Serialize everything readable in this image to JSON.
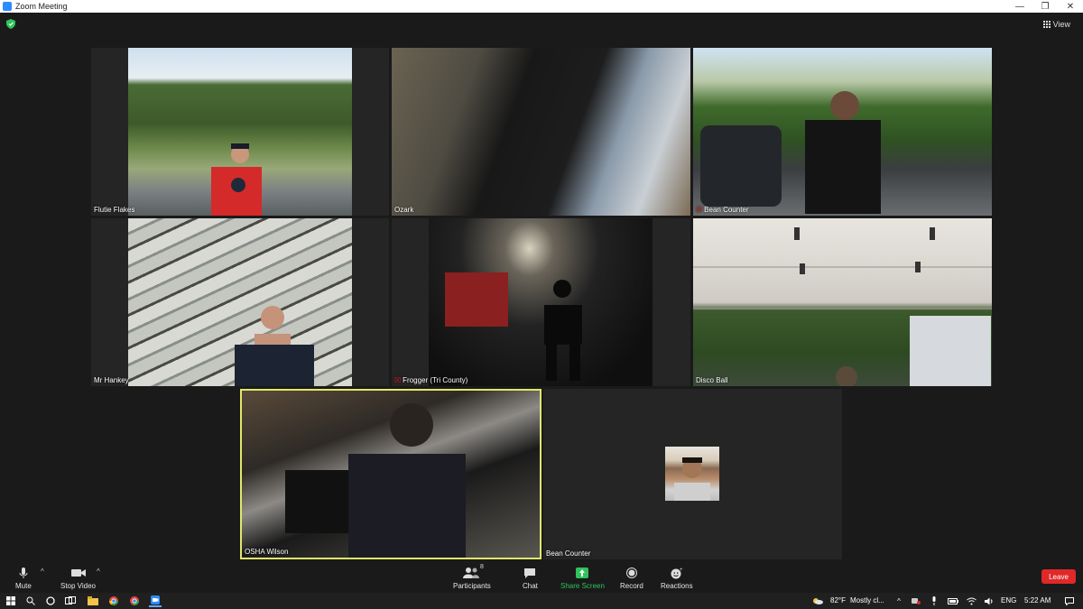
{
  "window": {
    "title": "Zoom Meeting"
  },
  "view_button": {
    "label": "View"
  },
  "participants_tiles": [
    {
      "name": "Flutie Flakes"
    },
    {
      "name": "Ozark"
    },
    {
      "name": "Bean Counter",
      "muted": true
    },
    {
      "name": "Mr Hankey"
    },
    {
      "name": "Frogger (Tri County)",
      "muted": true
    },
    {
      "name": "Disco Ball"
    },
    {
      "name": "OSHA Wilson",
      "active_speaker": true
    },
    {
      "name": "Bean Counter",
      "video_off": true
    }
  ],
  "toolbar": {
    "mute_label": "Mute",
    "stop_video_label": "Stop Video",
    "participants_label": "Participants",
    "participants_count": "8",
    "chat_label": "Chat",
    "share_screen_label": "Share Screen",
    "record_label": "Record",
    "reactions_label": "Reactions",
    "leave_label": "Leave"
  },
  "taskbar": {
    "weather": "82°F",
    "weather_desc": "Mostly cl...",
    "language": "ENG",
    "time": "5:22 AM"
  },
  "colors": {
    "active_speaker_border": "#dfe86a",
    "leave_button": "#e02828",
    "share_screen": "#2ec45a",
    "zoom_blue": "#2d8cff"
  }
}
